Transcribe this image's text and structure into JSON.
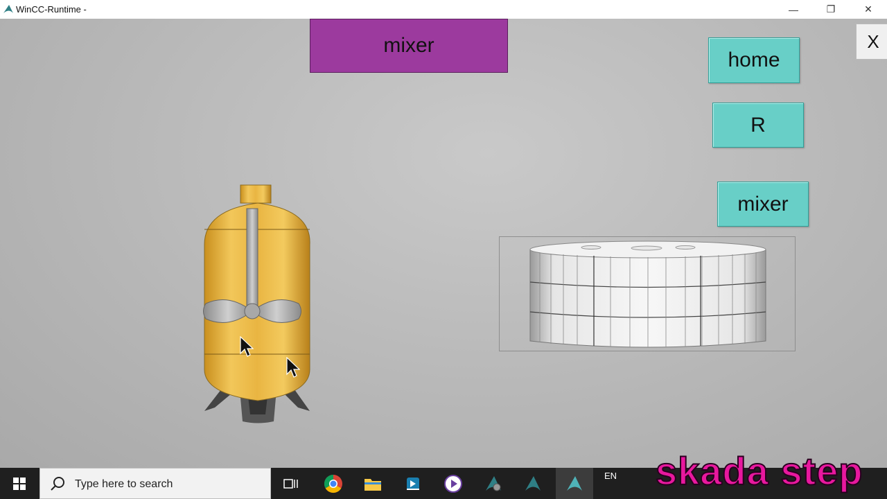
{
  "window": {
    "title": "WinCC-Runtime -",
    "minimize_glyph": "—",
    "maximize_glyph": "❐",
    "close_glyph": "✕"
  },
  "screen": {
    "header_label": "mixer",
    "buttons": {
      "home": "home",
      "r": "R",
      "mixer": "mixer",
      "close": "X"
    },
    "colors": {
      "header": "#9c3a9e",
      "nav_button": "#68cfc7",
      "vessel": "#e3b23c"
    }
  },
  "taskbar": {
    "search_placeholder": "Type here to search",
    "language": "EN",
    "icons": [
      "windows-start-icon",
      "task-view-icon",
      "chrome-icon",
      "file-explorer-icon",
      "app-icon",
      "media-player-icon",
      "wincc-config-icon",
      "wincc-icon",
      "wincc-runtime-icon"
    ]
  },
  "watermark": "skada step"
}
